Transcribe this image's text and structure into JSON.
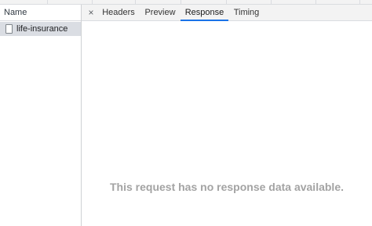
{
  "request_list": {
    "column_header": "Name",
    "requests": [
      {
        "name": "life-insurance",
        "icon": "document-icon",
        "selected": true
      }
    ]
  },
  "detail_panel": {
    "close_icon": "close-icon",
    "close_glyph": "×",
    "tabs": [
      {
        "label": "Headers",
        "active": false
      },
      {
        "label": "Preview",
        "active": false
      },
      {
        "label": "Response",
        "active": true
      },
      {
        "label": "Timing",
        "active": false
      }
    ],
    "empty_message": "This request has no response data available."
  },
  "colors": {
    "active_tab_underline": "#1a73e8",
    "selected_row": "#dadde3",
    "empty_text": "#a3a3a3"
  }
}
